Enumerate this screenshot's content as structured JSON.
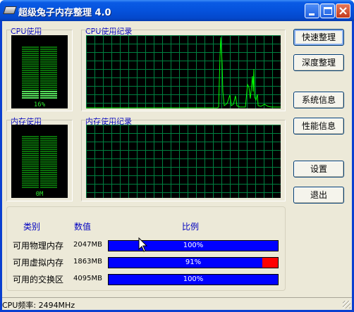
{
  "window": {
    "title": "超级兔子内存整理 4.0"
  },
  "cpu": {
    "usage_label": "CPU使用",
    "history_label": "CPU使用纪录",
    "usage_text": "16%",
    "usage_fraction": 0.16
  },
  "memory": {
    "usage_label": "内存使用",
    "history_label": "内存使用纪录",
    "usage_text": "0M",
    "usage_fraction": 0
  },
  "buttons": {
    "quick_clean": "快速整理",
    "deep_clean": "深度整理",
    "system_info": "系统信息",
    "performance_info": "性能信息",
    "settings": "设置",
    "exit": "退出"
  },
  "stats": {
    "headers": {
      "category": "类别",
      "value": "数值",
      "ratio": "比例"
    },
    "rows": [
      {
        "label": "可用物理内存",
        "value": "2047MB",
        "percent_text": "100%",
        "fraction": 1.0
      },
      {
        "label": "可用虚拟内存",
        "value": "1863MB",
        "percent_text": "91%",
        "fraction": 0.91
      },
      {
        "label": "可用的交换区",
        "value": "4095MB",
        "percent_text": "100%",
        "fraction": 1.0
      }
    ]
  },
  "status": {
    "text": "CPU频率: 2494MHz"
  },
  "colors": {
    "graph_grid": "#008040",
    "graph_line": "#00ff00",
    "bar_used": "#0000ff",
    "bar_free": "#ff0000"
  }
}
